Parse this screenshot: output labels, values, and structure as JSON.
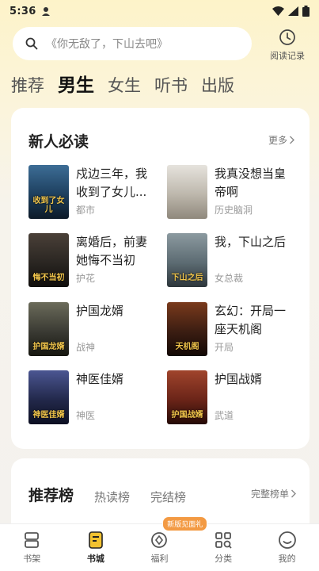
{
  "status": {
    "time": "5:36"
  },
  "search": {
    "placeholder": "《你无敌了，下山去吧》"
  },
  "history": {
    "label": "阅读记录"
  },
  "tabs": [
    {
      "label": "推荐",
      "active": false
    },
    {
      "label": "男生",
      "active": true
    },
    {
      "label": "女生",
      "active": false
    },
    {
      "label": "听书",
      "active": false
    },
    {
      "label": "出版",
      "active": false
    }
  ],
  "new_reads": {
    "title": "新人必读",
    "more": "更多",
    "books": [
      {
        "title": "戍边三年，我收到了女儿...",
        "tag": "都市",
        "cover_text": "收到了女儿",
        "cover_color": "#1d3f5e"
      },
      {
        "title": "我真没想当皇帝啊",
        "tag": "历史脑洞",
        "cover_text": "",
        "cover_color": "#c9c4ba"
      },
      {
        "title": "离婚后，前妻她悔不当初",
        "tag": "护花",
        "cover_text": "悔不当初",
        "cover_color": "#2a2622"
      },
      {
        "title": "我，下山之后",
        "tag": "女总裁",
        "cover_text": "下山之后",
        "cover_color": "#5c6b72"
      },
      {
        "title": "护国龙婿",
        "tag": "战神",
        "cover_text": "护国龙婿",
        "cover_color": "#3a3a33"
      },
      {
        "title": "玄幻：开局一座天机阁",
        "tag": "开局",
        "cover_text": "天机阁",
        "cover_color": "#3b1d12"
      },
      {
        "title": "神医佳婿",
        "tag": "神医",
        "cover_text": "神医佳婿",
        "cover_color": "#22284a"
      },
      {
        "title": "护国战婿",
        "tag": "武道",
        "cover_text": "护国战婿",
        "cover_color": "#6a2418"
      }
    ]
  },
  "ranking": {
    "tabs": [
      {
        "label": "推荐榜",
        "active": true
      },
      {
        "label": "热读榜",
        "active": false
      },
      {
        "label": "完结榜",
        "active": false
      }
    ],
    "more": "完整榜单"
  },
  "bottom_nav": [
    {
      "label": "书架",
      "icon": "bookshelf-icon",
      "active": false
    },
    {
      "label": "书城",
      "icon": "bookstore-icon",
      "active": true
    },
    {
      "label": "福利",
      "icon": "welfare-icon",
      "active": false,
      "badge": "新版见面礼"
    },
    {
      "label": "分类",
      "icon": "category-icon",
      "active": false
    },
    {
      "label": "我的",
      "icon": "profile-icon",
      "active": false
    }
  ],
  "colors": {
    "accent": "#f2c230",
    "background": "#fbf4dc",
    "badge": "#f39a43"
  }
}
